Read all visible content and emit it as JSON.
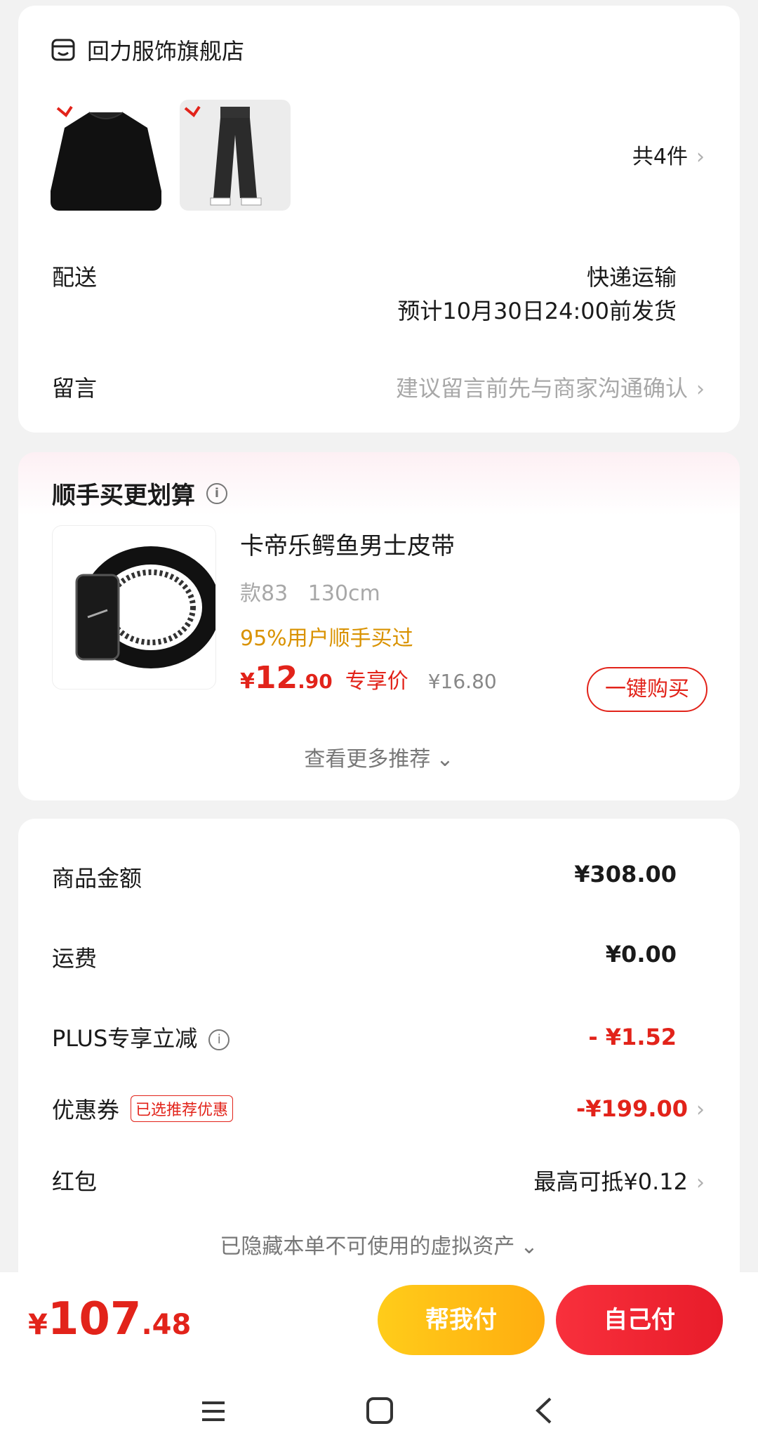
{
  "shop": {
    "name": "回力服饰旗舰店",
    "item_count": "共4件",
    "delivery_label": "配送",
    "delivery_method": "快递运输",
    "delivery_eta": "预计10月30日24:00前发货",
    "message_label": "留言",
    "message_placeholder": "建议留言前先与商家沟通确认"
  },
  "recommend": {
    "title": "顺手买更划算",
    "product_name": "卡帝乐鳄鱼男士皮带",
    "spec": "款83   130cm",
    "popularity": "95%用户顺手买过",
    "currency": "¥",
    "price_int": "12",
    "price_dec": ".90",
    "price_tag": "专享价",
    "orig_price": "¥16.80",
    "buy_button": "一键购买",
    "more": "查看更多推荐"
  },
  "summary": {
    "rows": [
      {
        "label": "商品金额",
        "value": "¥308.00"
      },
      {
        "label": "运费",
        "value": "¥0.00"
      },
      {
        "label": "PLUS专享立减",
        "value": "- ¥1.52"
      },
      {
        "label": "优惠券",
        "badge": "已选推荐优惠",
        "value": "-¥199.00"
      },
      {
        "label": "红包",
        "value": "最高可抵¥0.12"
      }
    ],
    "hidden_note": "已隐藏本单不可使用的虚拟资产"
  },
  "checkout": {
    "currency": "¥",
    "total_int": "107",
    "total_dec": ".48",
    "help_pay": "帮我付",
    "self_pay": "自己付"
  },
  "colors": {
    "accent_red": "#e2231a",
    "help_pay_yellow": "#ffc107",
    "orange_text": "#d99200"
  },
  "icons": [
    "shop-icon",
    "chevron-right-icon",
    "info-icon",
    "chevron-down-icon",
    "menu-icon",
    "home-icon",
    "back-icon"
  ]
}
